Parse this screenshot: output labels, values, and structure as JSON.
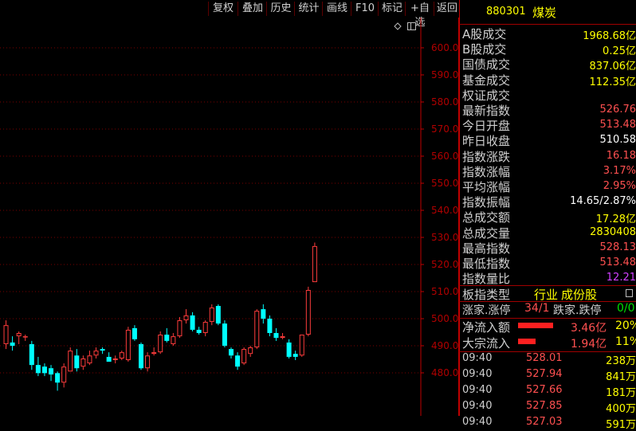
{
  "toolbar": {
    "buttons": [
      "复权",
      "叠加",
      "历史",
      "统计",
      "画线",
      "F10",
      "标记",
      "+自选",
      "返回"
    ]
  },
  "chart_icons": [
    "diamond-icon",
    "window-icon"
  ],
  "chart_data": {
    "type": "candlestick",
    "ylim": [
      474,
      607
    ],
    "yticks": [
      "600.0",
      "590.0",
      "580.0",
      "570.0",
      "560.0",
      "550.0",
      "540.0",
      "530.0",
      "520.0",
      "510.0",
      "500.0",
      "490.0",
      "480.0"
    ],
    "candles": [
      {
        "o": 490.6,
        "h": 499.4,
        "l": 488.8,
        "c": 497.6
      },
      {
        "o": 491.2,
        "h": 493.5,
        "l": 488.2,
        "c": 490.0
      },
      {
        "o": 493.5,
        "h": 495.3,
        "l": 490.6,
        "c": 494.7
      },
      {
        "o": 493.5,
        "h": 494.1,
        "l": 491.8,
        "c": 493.5
      },
      {
        "o": 490.6,
        "h": 491.8,
        "l": 481.1,
        "c": 482.9
      },
      {
        "o": 482.9,
        "h": 485.9,
        "l": 478.8,
        "c": 479.9
      },
      {
        "o": 482.3,
        "h": 483.5,
        "l": 478.8,
        "c": 479.9
      },
      {
        "o": 481.7,
        "h": 482.9,
        "l": 477.0,
        "c": 479.4
      },
      {
        "o": 479.9,
        "h": 480.5,
        "l": 473.4,
        "c": 476.4
      },
      {
        "o": 476.4,
        "h": 483.5,
        "l": 474.6,
        "c": 482.3
      },
      {
        "o": 480.5,
        "h": 489.4,
        "l": 480.5,
        "c": 488.2
      },
      {
        "o": 486.4,
        "h": 488.8,
        "l": 480.5,
        "c": 481.7
      },
      {
        "o": 482.3,
        "h": 486.4,
        "l": 481.1,
        "c": 485.3
      },
      {
        "o": 483.5,
        "h": 488.2,
        "l": 482.9,
        "c": 486.4
      },
      {
        "o": 486.4,
        "h": 489.4,
        "l": 485.3,
        "c": 488.2
      },
      {
        "o": 488.8,
        "h": 489.4,
        "l": 487.0,
        "c": 488.2
      },
      {
        "o": 485.9,
        "h": 487.6,
        "l": 484.1,
        "c": 484.1
      },
      {
        "o": 484.7,
        "h": 486.4,
        "l": 483.5,
        "c": 485.3
      },
      {
        "o": 485.3,
        "h": 488.2,
        "l": 484.7,
        "c": 487.6
      },
      {
        "o": 484.7,
        "h": 497.0,
        "l": 484.1,
        "c": 495.9
      },
      {
        "o": 496.5,
        "h": 497.6,
        "l": 491.8,
        "c": 492.4
      },
      {
        "o": 490.6,
        "h": 491.2,
        "l": 481.1,
        "c": 481.7
      },
      {
        "o": 481.7,
        "h": 487.6,
        "l": 480.5,
        "c": 486.4
      },
      {
        "o": 487.0,
        "h": 489.4,
        "l": 486.4,
        "c": 487.6
      },
      {
        "o": 487.6,
        "h": 495.3,
        "l": 487.0,
        "c": 494.1
      },
      {
        "o": 494.1,
        "h": 496.5,
        "l": 491.2,
        "c": 491.8
      },
      {
        "o": 490.6,
        "h": 494.7,
        "l": 490.0,
        "c": 493.5
      },
      {
        "o": 493.5,
        "h": 500.6,
        "l": 492.9,
        "c": 499.4
      },
      {
        "o": 499.4,
        "h": 503.5,
        "l": 498.2,
        "c": 501.2
      },
      {
        "o": 501.2,
        "h": 502.4,
        "l": 495.3,
        "c": 495.9
      },
      {
        "o": 495.9,
        "h": 497.0,
        "l": 494.1,
        "c": 494.7
      },
      {
        "o": 494.7,
        "h": 499.4,
        "l": 493.5,
        "c": 498.8
      },
      {
        "o": 498.8,
        "h": 505.3,
        "l": 497.6,
        "c": 504.1
      },
      {
        "o": 504.7,
        "h": 505.3,
        "l": 497.6,
        "c": 498.2
      },
      {
        "o": 498.2,
        "h": 499.4,
        "l": 489.4,
        "c": 490.0
      },
      {
        "o": 488.8,
        "h": 489.4,
        "l": 485.3,
        "c": 486.4
      },
      {
        "o": 486.4,
        "h": 487.6,
        "l": 481.1,
        "c": 482.3
      },
      {
        "o": 483.5,
        "h": 489.4,
        "l": 482.9,
        "c": 488.8
      },
      {
        "o": 487.0,
        "h": 490.0,
        "l": 485.9,
        "c": 489.4
      },
      {
        "o": 489.4,
        "h": 503.5,
        "l": 488.8,
        "c": 502.9
      },
      {
        "o": 503.5,
        "h": 505.3,
        "l": 498.2,
        "c": 500.0
      },
      {
        "o": 500.0,
        "h": 501.2,
        "l": 493.5,
        "c": 494.7
      },
      {
        "o": 494.7,
        "h": 496.5,
        "l": 491.8,
        "c": 492.9
      },
      {
        "o": 492.9,
        "h": 494.7,
        "l": 492.4,
        "c": 493.5
      },
      {
        "o": 491.2,
        "h": 492.4,
        "l": 485.3,
        "c": 485.9
      },
      {
        "o": 487.0,
        "h": 488.2,
        "l": 484.7,
        "c": 485.9
      },
      {
        "o": 486.4,
        "h": 494.1,
        "l": 485.9,
        "c": 494.1
      },
      {
        "o": 494.1,
        "h": 511.8,
        "l": 493.5,
        "c": 510.6
      },
      {
        "o": 513.5,
        "h": 528.1,
        "l": 513.5,
        "c": 526.8
      }
    ]
  },
  "panel": {
    "code": "880301",
    "name": "煤炭",
    "rows": [
      {
        "label": "A股成交",
        "value": "1968.68亿",
        "color": "yel"
      },
      {
        "label": "B股成交",
        "value": "0.25亿",
        "color": "yel"
      },
      {
        "label": "国债成交",
        "value": "837.06亿",
        "color": "yel"
      },
      {
        "label": "基金成交",
        "value": "112.35亿",
        "color": "yel"
      },
      {
        "label": "权证成交",
        "value": "",
        "color": "yel"
      },
      {
        "label": "最新指数",
        "value": "526.76",
        "color": "red"
      },
      {
        "label": "今日开盘",
        "value": "513.48",
        "color": "red"
      },
      {
        "label": "昨日收盘",
        "value": "510.58",
        "color": "wht"
      },
      {
        "label": "指数涨跌",
        "value": "16.18",
        "color": "red"
      },
      {
        "label": "指数涨幅",
        "value": "3.17%",
        "color": "red"
      },
      {
        "label": "平均涨幅",
        "value": "2.95%",
        "color": "red"
      },
      {
        "label": "指数振幅",
        "value": "14.65/2.87%",
        "color": "wht"
      },
      {
        "label": "总成交额",
        "value": "17.28亿",
        "color": "yel"
      },
      {
        "label": "总成交量",
        "value": "2830408",
        "color": "yel"
      },
      {
        "label": "最高指数",
        "value": "528.13",
        "color": "red"
      },
      {
        "label": "最低指数",
        "value": "513.48",
        "color": "red"
      },
      {
        "label": "指数量比",
        "value": "12.21",
        "color": "pur"
      }
    ],
    "board_type_label": "板指类型",
    "board_type_value": "行业",
    "components_label": "成份股",
    "rise_label": "涨家.涨停",
    "rise_value": "34/1",
    "fall_label": "跌家.跌停",
    "fall_value": "0/0",
    "flows": [
      {
        "label": "净流入额",
        "amount": "3.46亿",
        "pct": "20%"
      },
      {
        "label": "大宗流入",
        "amount": "1.94亿",
        "pct": "11%"
      }
    ],
    "ticks": [
      {
        "time": "09:40",
        "price": "528.01",
        "vol": "238万"
      },
      {
        "time": "09:40",
        "price": "527.94",
        "vol": "841万"
      },
      {
        "time": "09:40",
        "price": "527.66",
        "vol": "181万"
      },
      {
        "time": "09:40",
        "price": "527.85",
        "vol": "400万"
      },
      {
        "time": "09:40",
        "price": "527.03",
        "vol": "591万"
      }
    ]
  }
}
